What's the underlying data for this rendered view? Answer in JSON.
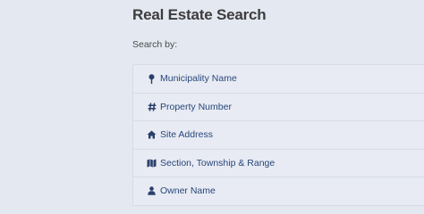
{
  "header": {
    "title": "Real Estate Search",
    "subtitle": "Search by:"
  },
  "search_options": [
    {
      "label": "Municipality Name",
      "icon": "map-marker-icon"
    },
    {
      "label": "Property Number",
      "icon": "hash-icon"
    },
    {
      "label": "Site Address",
      "icon": "home-icon"
    },
    {
      "label": "Section, Township & Range",
      "icon": "map-icon"
    },
    {
      "label": "Owner Name",
      "icon": "user-icon"
    }
  ],
  "colors": {
    "background": "#e4e8f1",
    "link": "#27467a",
    "icon": "#2a3f6b",
    "title": "#3d3d3d"
  }
}
